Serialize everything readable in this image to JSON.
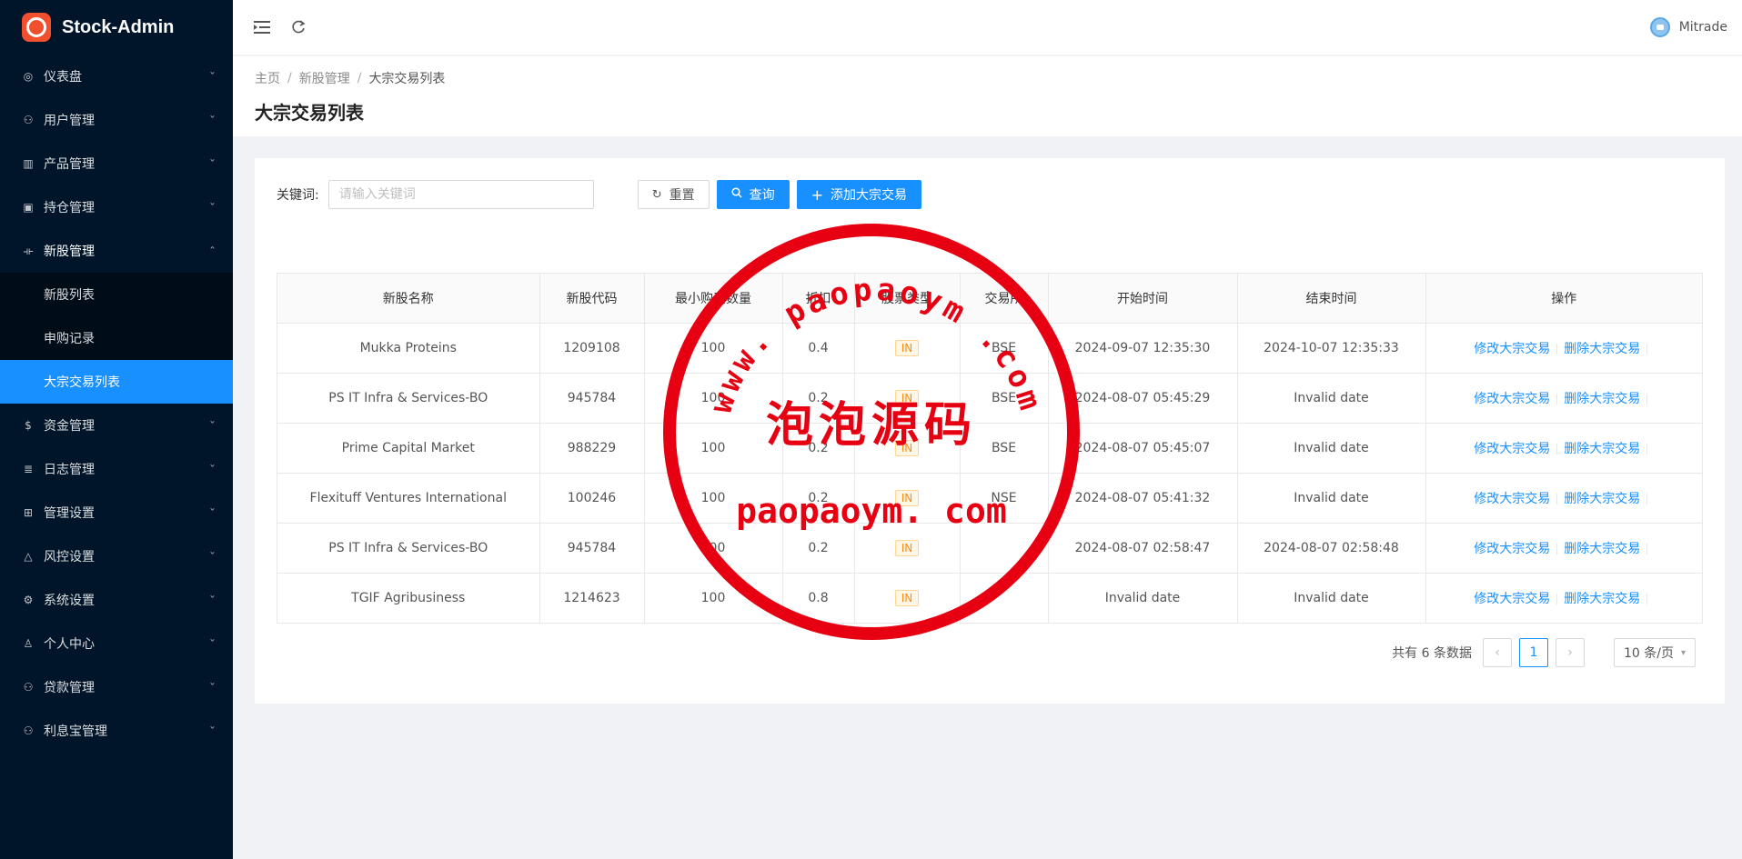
{
  "app": {
    "title": "Stock-Admin"
  },
  "sidebar": {
    "items": [
      {
        "label": "仪表盘",
        "icon": "dashboard-icon"
      },
      {
        "label": "用户管理",
        "icon": "user-manage-icon"
      },
      {
        "label": "产品管理",
        "icon": "chart-icon"
      },
      {
        "label": "持仓管理",
        "icon": "position-icon"
      },
      {
        "label": "新股管理",
        "icon": "ipo-icon"
      },
      {
        "label": "资金管理",
        "icon": "money-icon"
      },
      {
        "label": "日志管理",
        "icon": "log-icon"
      },
      {
        "label": "管理设置",
        "icon": "admin-settings-icon"
      },
      {
        "label": "风控设置",
        "icon": "warning-icon"
      },
      {
        "label": "系统设置",
        "icon": "gear-icon"
      },
      {
        "label": "个人中心",
        "icon": "person-icon"
      },
      {
        "label": "贷款管理",
        "icon": "loan-icon"
      },
      {
        "label": "利息宝管理",
        "icon": "interest-icon"
      }
    ],
    "submenu": [
      {
        "label": "新股列表"
      },
      {
        "label": "申购记录"
      },
      {
        "label": "大宗交易列表"
      }
    ]
  },
  "header": {
    "user_name": "Mitrade"
  },
  "breadcrumb": {
    "home": "主页",
    "parent": "新股管理",
    "current": "大宗交易列表"
  },
  "page": {
    "title": "大宗交易列表"
  },
  "filter": {
    "keyword_label": "关键词:",
    "keyword_placeholder": "请输入关键词",
    "reset_label": "重置",
    "query_label": "查询",
    "add_label": "添加大宗交易"
  },
  "table": {
    "columns": [
      "新股名称",
      "新股代码",
      "最小购买数量",
      "折扣",
      "股票类型",
      "交易所",
      "开始时间",
      "结束时间",
      "操作"
    ],
    "rows": [
      {
        "name": "Mukka Proteins",
        "code": "1209108",
        "min_qty": "100",
        "discount": "0.4",
        "type": "IN",
        "exchange": "BSE",
        "start": "2024-09-07 12:35:30",
        "end": "2024-10-07 12:35:33"
      },
      {
        "name": "PS IT Infra & Services-BO",
        "code": "945784",
        "min_qty": "100",
        "discount": "0.2",
        "type": "IN",
        "exchange": "BSE",
        "start": "2024-08-07 05:45:29",
        "end": "Invalid date"
      },
      {
        "name": "Prime Capital Market",
        "code": "988229",
        "min_qty": "100",
        "discount": "0.2",
        "type": "IN",
        "exchange": "BSE",
        "start": "2024-08-07 05:45:07",
        "end": "Invalid date"
      },
      {
        "name": "Flexituff Ventures International",
        "code": "100246",
        "min_qty": "100",
        "discount": "0.2",
        "type": "IN",
        "exchange": "NSE",
        "start": "2024-08-07 05:41:32",
        "end": "Invalid date"
      },
      {
        "name": "PS IT Infra & Services-BO",
        "code": "945784",
        "min_qty": "100",
        "discount": "0.2",
        "type": "IN",
        "exchange": "",
        "start": "2024-08-07 02:58:47",
        "end": "2024-08-07 02:58:48"
      },
      {
        "name": "TGIF Agribusiness",
        "code": "1214623",
        "min_qty": "100",
        "discount": "0.8",
        "type": "IN",
        "exchange": "",
        "start": "Invalid date",
        "end": "Invalid date"
      }
    ],
    "edit_label": "修改大宗交易",
    "delete_label": "删除大宗交易"
  },
  "pagination": {
    "total_text": "共有 6 条数据",
    "current_page": "1",
    "page_size": "10 条/页"
  },
  "watermark": {
    "line1": "www. paopaoym .com",
    "line2": "泡泡源码",
    "line3": "paopaoym. com",
    "color": "#e60012"
  }
}
